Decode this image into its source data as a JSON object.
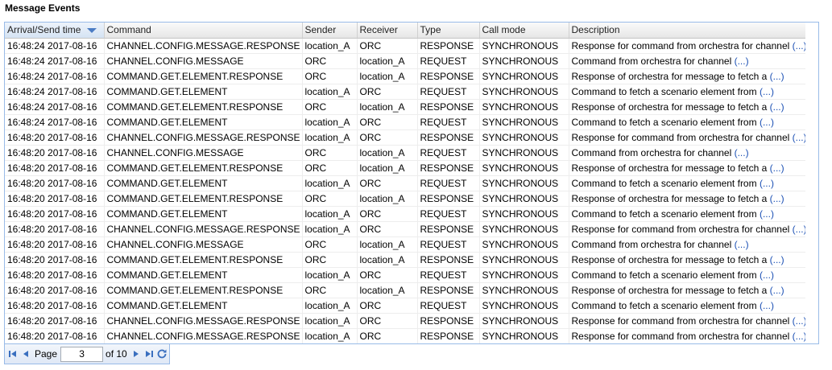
{
  "panel": {
    "title": "Message Events"
  },
  "columns": [
    "Arrival/Send time",
    "Command",
    "Sender",
    "Receiver",
    "Type",
    "Call mode",
    "Description"
  ],
  "more_label": "(...)",
  "rows": [
    {
      "time": "16:48:24 2017-08-16",
      "command": "CHANNEL.CONFIG.MESSAGE.RESPONSE",
      "sender": "location_A",
      "receiver": "ORC",
      "type": "RESPONSE",
      "call_mode": "SYNCHRONOUS",
      "description": "Response for command from orchestra for channel"
    },
    {
      "time": "16:48:24 2017-08-16",
      "command": "CHANNEL.CONFIG.MESSAGE",
      "sender": "ORC",
      "receiver": "location_A",
      "type": "REQUEST",
      "call_mode": "SYNCHRONOUS",
      "description": "Command from orchestra for channel"
    },
    {
      "time": "16:48:24 2017-08-16",
      "command": "COMMAND.GET.ELEMENT.RESPONSE",
      "sender": "ORC",
      "receiver": "location_A",
      "type": "RESPONSE",
      "call_mode": "SYNCHRONOUS",
      "description": "Response of orchestra for message to fetch a"
    },
    {
      "time": "16:48:24 2017-08-16",
      "command": "COMMAND.GET.ELEMENT",
      "sender": "location_A",
      "receiver": "ORC",
      "type": "REQUEST",
      "call_mode": "SYNCHRONOUS",
      "description": "Command to fetch a scenario element from"
    },
    {
      "time": "16:48:24 2017-08-16",
      "command": "COMMAND.GET.ELEMENT.RESPONSE",
      "sender": "ORC",
      "receiver": "location_A",
      "type": "RESPONSE",
      "call_mode": "SYNCHRONOUS",
      "description": "Response of orchestra for message to fetch a"
    },
    {
      "time": "16:48:24 2017-08-16",
      "command": "COMMAND.GET.ELEMENT",
      "sender": "location_A",
      "receiver": "ORC",
      "type": "REQUEST",
      "call_mode": "SYNCHRONOUS",
      "description": "Command to fetch a scenario element from"
    },
    {
      "time": "16:48:20 2017-08-16",
      "command": "CHANNEL.CONFIG.MESSAGE.RESPONSE",
      "sender": "location_A",
      "receiver": "ORC",
      "type": "RESPONSE",
      "call_mode": "SYNCHRONOUS",
      "description": "Response for command from orchestra for channel"
    },
    {
      "time": "16:48:20 2017-08-16",
      "command": "CHANNEL.CONFIG.MESSAGE",
      "sender": "ORC",
      "receiver": "location_A",
      "type": "REQUEST",
      "call_mode": "SYNCHRONOUS",
      "description": "Command from orchestra for channel"
    },
    {
      "time": "16:48:20 2017-08-16",
      "command": "COMMAND.GET.ELEMENT.RESPONSE",
      "sender": "ORC",
      "receiver": "location_A",
      "type": "RESPONSE",
      "call_mode": "SYNCHRONOUS",
      "description": "Response of orchestra for message to fetch a"
    },
    {
      "time": "16:48:20 2017-08-16",
      "command": "COMMAND.GET.ELEMENT",
      "sender": "location_A",
      "receiver": "ORC",
      "type": "REQUEST",
      "call_mode": "SYNCHRONOUS",
      "description": "Command to fetch a scenario element from"
    },
    {
      "time": "16:48:20 2017-08-16",
      "command": "COMMAND.GET.ELEMENT.RESPONSE",
      "sender": "ORC",
      "receiver": "location_A",
      "type": "RESPONSE",
      "call_mode": "SYNCHRONOUS",
      "description": "Response of orchestra for message to fetch a"
    },
    {
      "time": "16:48:20 2017-08-16",
      "command": "COMMAND.GET.ELEMENT",
      "sender": "location_A",
      "receiver": "ORC",
      "type": "REQUEST",
      "call_mode": "SYNCHRONOUS",
      "description": "Command to fetch a scenario element from"
    },
    {
      "time": "16:48:20 2017-08-16",
      "command": "CHANNEL.CONFIG.MESSAGE.RESPONSE",
      "sender": "location_A",
      "receiver": "ORC",
      "type": "RESPONSE",
      "call_mode": "SYNCHRONOUS",
      "description": "Response for command from orchestra for channel"
    },
    {
      "time": "16:48:20 2017-08-16",
      "command": "CHANNEL.CONFIG.MESSAGE",
      "sender": "ORC",
      "receiver": "location_A",
      "type": "REQUEST",
      "call_mode": "SYNCHRONOUS",
      "description": "Command from orchestra for channel"
    },
    {
      "time": "16:48:20 2017-08-16",
      "command": "COMMAND.GET.ELEMENT.RESPONSE",
      "sender": "ORC",
      "receiver": "location_A",
      "type": "RESPONSE",
      "call_mode": "SYNCHRONOUS",
      "description": "Response of orchestra for message to fetch a"
    },
    {
      "time": "16:48:20 2017-08-16",
      "command": "COMMAND.GET.ELEMENT",
      "sender": "location_A",
      "receiver": "ORC",
      "type": "REQUEST",
      "call_mode": "SYNCHRONOUS",
      "description": "Command to fetch a scenario element from"
    },
    {
      "time": "16:48:20 2017-08-16",
      "command": "COMMAND.GET.ELEMENT.RESPONSE",
      "sender": "ORC",
      "receiver": "location_A",
      "type": "RESPONSE",
      "call_mode": "SYNCHRONOUS",
      "description": "Response of orchestra for message to fetch a"
    },
    {
      "time": "16:48:20 2017-08-16",
      "command": "COMMAND.GET.ELEMENT",
      "sender": "location_A",
      "receiver": "ORC",
      "type": "REQUEST",
      "call_mode": "SYNCHRONOUS",
      "description": "Command to fetch a scenario element from"
    },
    {
      "time": "16:48:20 2017-08-16",
      "command": "CHANNEL.CONFIG.MESSAGE.RESPONSE",
      "sender": "location_A",
      "receiver": "ORC",
      "type": "RESPONSE",
      "call_mode": "SYNCHRONOUS",
      "description": "Response for command from orchestra for channel"
    },
    {
      "time": "16:48:20 2017-08-16",
      "command": "CHANNEL.CONFIG.MESSAGE.RESPONSE",
      "sender": "location_A",
      "receiver": "ORC",
      "type": "RESPONSE",
      "call_mode": "SYNCHRONOUS",
      "description": "Response for command from orchestra for channel"
    }
  ],
  "pager": {
    "page_label": "Page",
    "current_page": "3",
    "of_label": "of 10",
    "icons": [
      "first-page-icon",
      "prev-page-icon",
      "next-page-icon",
      "last-page-icon",
      "refresh-icon"
    ]
  },
  "colors": {
    "grid_border": "#99bbe8",
    "link": "#1a4fb4",
    "sort_arrow": "#4b7cc4",
    "pager_icon": "#3a6fbf"
  }
}
